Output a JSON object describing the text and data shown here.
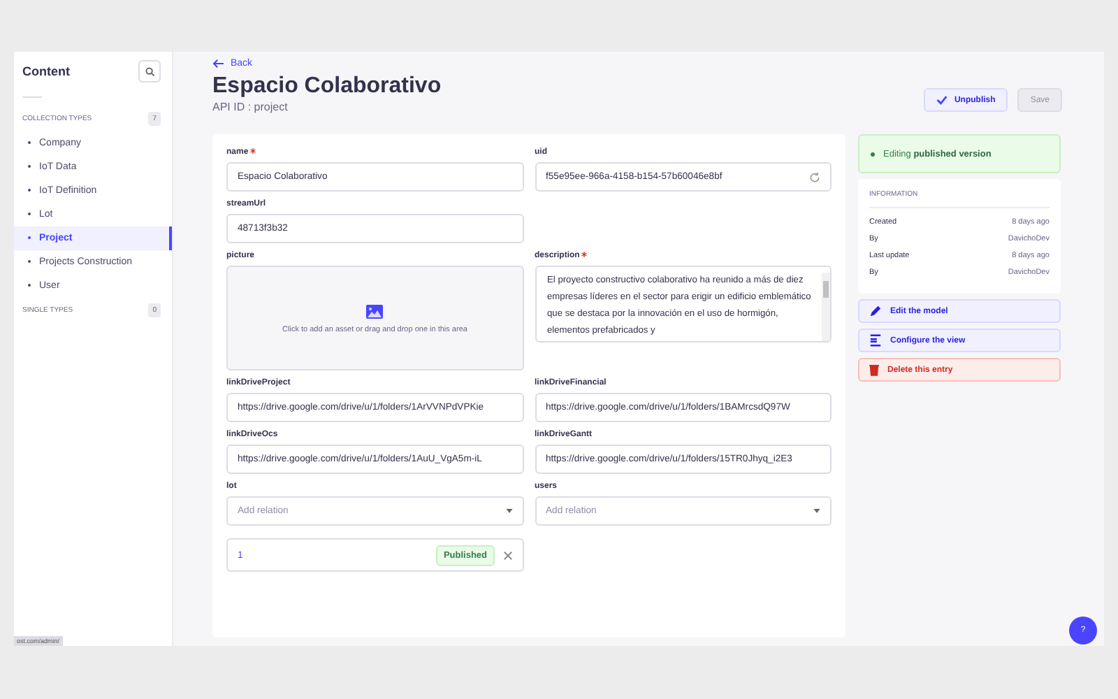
{
  "sidebar": {
    "title": "Content",
    "sections": [
      {
        "label": "COLLECTION TYPES",
        "count": "7",
        "items": [
          {
            "label": "Company",
            "selected": false
          },
          {
            "label": "IoT Data",
            "selected": false
          },
          {
            "label": "IoT Definition",
            "selected": false
          },
          {
            "label": "Lot",
            "selected": false
          },
          {
            "label": "Project",
            "selected": true
          },
          {
            "label": "Projects Construction",
            "selected": false
          },
          {
            "label": "User",
            "selected": false
          }
        ]
      },
      {
        "label": "SINGLE TYPES",
        "count": "0"
      }
    ]
  },
  "status_url": "ost.com/admin/",
  "header": {
    "back": "Back",
    "title": "Espacio Colaborativo",
    "subtitle": "API ID : project",
    "buttons": [
      {
        "label": "Unpublish",
        "kind": "primary"
      },
      {
        "label": "Save",
        "kind": "disabled"
      }
    ]
  },
  "fields": [
    {
      "label": "name",
      "required": true,
      "kind": "text",
      "value": "Espacio Colaborativo"
    },
    {
      "label": "uid",
      "required": false,
      "kind": "uid",
      "value": "f55e95ee-966a-4158-b154-57b60046e8bf"
    },
    {
      "label": "streamUrl",
      "required": false,
      "kind": "text",
      "value": "48713f3b32"
    },
    {
      "label": "picture",
      "required": false,
      "kind": "media",
      "placeholder": "Click to add an asset or drag and drop one in this area"
    },
    {
      "label": "description",
      "required": true,
      "kind": "textarea",
      "value": "El proyecto constructivo colaborativo ha reunido a más de diez empresas líderes en el sector para erigir un edificio emblemático que se destaca por la innovación en el uso de hormigón, elementos prefabricados y"
    },
    {
      "label": "linkDriveProject",
      "required": false,
      "kind": "text",
      "value": "https://drive.google.com/drive/u/1/folders/1ArVVNPdVPKie"
    },
    {
      "label": "linkDriveFinancial",
      "required": false,
      "kind": "text",
      "value": "https://drive.google.com/drive/u/1/folders/1BAMrcsdQ97W"
    },
    {
      "label": "linkDriveOcs",
      "required": false,
      "kind": "text",
      "value": "https://drive.google.com/drive/u/1/folders/1AuU_VgA5m-iL"
    },
    {
      "label": "linkDriveGantt",
      "required": false,
      "kind": "text",
      "value": "https://drive.google.com/drive/u/1/folders/15TR0Jhyq_i2E3"
    },
    {
      "label": "lot",
      "required": false,
      "kind": "relation",
      "placeholder": "Add relation",
      "related": [
        {
          "name": "1",
          "status": "Published"
        }
      ]
    },
    {
      "label": "users",
      "required": false,
      "kind": "relation",
      "placeholder": "Add relation"
    }
  ],
  "status_panel": {
    "text": "Editing **published version**"
  },
  "information": {
    "title": "INFORMATION",
    "rows": [
      {
        "label": "Created",
        "value": "8 days ago"
      },
      {
        "label": "By",
        "value": "DavichoDev"
      },
      {
        "label": "Last update",
        "value": "8 days ago"
      },
      {
        "label": "By",
        "value": "DavichoDev"
      }
    ]
  },
  "actions": [
    {
      "label": "Edit the model",
      "kind": "edit"
    },
    {
      "label": "Configure the view",
      "kind": "configure"
    },
    {
      "label": "Delete this entry",
      "kind": "delete"
    }
  ],
  "help_button": {
    "label": "?"
  }
}
